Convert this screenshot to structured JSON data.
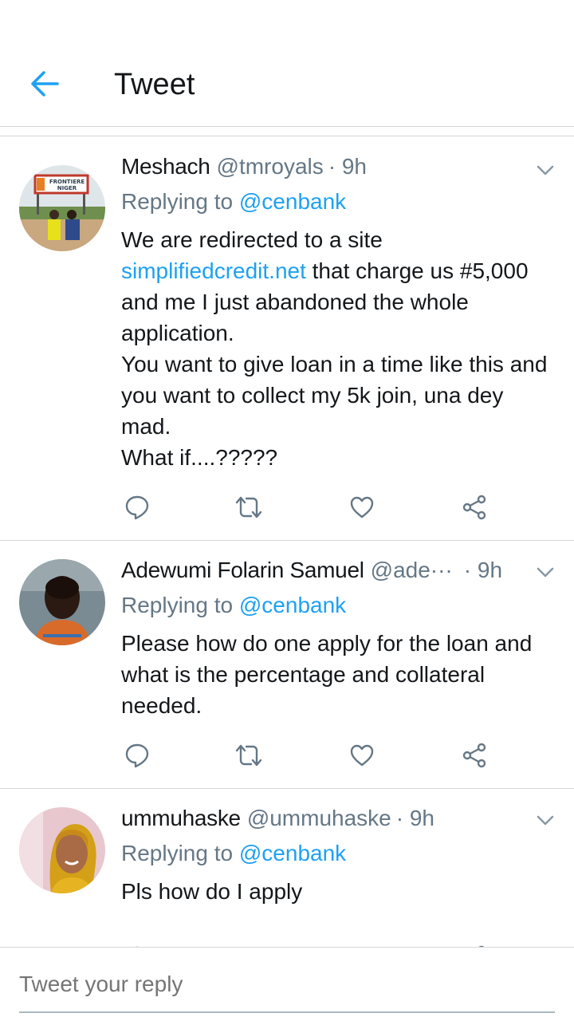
{
  "header": {
    "title": "Tweet"
  },
  "tweets": [
    {
      "name": "Meshach",
      "handle": "@tmroyals",
      "time": "· 9h",
      "replying_prefix": "Replying to ",
      "replying_to": "@cenbank",
      "text_parts": [
        "We are redirected to a site ",
        "simplifiedcredit.net",
        " that charge us #5,000 and me I just abandoned the whole application.",
        "You want to give loan in a time like this and you want to collect my 5k join, una dey mad.",
        "What if....?????"
      ],
      "avatar_sign": [
        "FRONTIERE",
        "NIGER"
      ]
    },
    {
      "name": "Adewumi Folarin Samuel",
      "handle": "@ade···",
      "time": "· 9h",
      "replying_prefix": "Replying to ",
      "replying_to": "@cenbank",
      "text": "Please how do one apply for the loan and what is the percentage and collateral needed."
    },
    {
      "name": "ummuhaske",
      "handle": "@ummuhaske",
      "time": "· 9h",
      "replying_prefix": "Replying to ",
      "replying_to": "@cenbank",
      "text": "Pls how do I apply"
    }
  ],
  "composer": {
    "placeholder": "Tweet your reply"
  },
  "colors": {
    "accent": "#1da1f2",
    "secondary_text": "#657786",
    "primary_text": "#14171a",
    "divider": "#d4d7da"
  },
  "icons": [
    "back-arrow-icon",
    "chevron-down-icon",
    "reply-icon",
    "retweet-icon",
    "like-icon",
    "share-icon"
  ]
}
